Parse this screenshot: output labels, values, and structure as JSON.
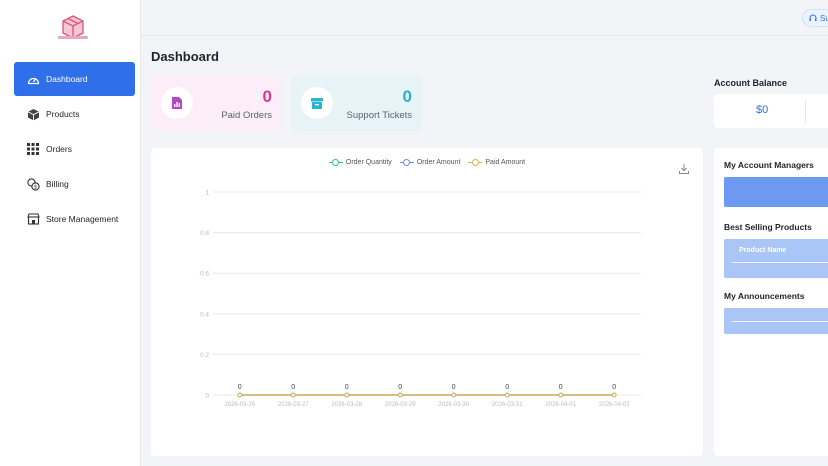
{
  "sidebar": {
    "items": [
      {
        "label": "Dashboard",
        "icon": "dashboard-gauge-icon",
        "active": true
      },
      {
        "label": "Products",
        "icon": "box-icon",
        "active": false
      },
      {
        "label": "Orders",
        "icon": "grid-icon",
        "active": false
      },
      {
        "label": "Billing",
        "icon": "coins-icon",
        "active": false
      },
      {
        "label": "Store Management",
        "icon": "store-icon",
        "active": false
      }
    ]
  },
  "topbar": {
    "support_label": "Su"
  },
  "page": {
    "title": "Dashboard"
  },
  "stats": [
    {
      "value": "0",
      "label": "Paid Orders",
      "icon": "chart-doc-icon",
      "bg": "#fbeef8",
      "color": "#d63a86",
      "icon_color": "#b245c8"
    },
    {
      "value": "0",
      "label": "Support Tickets",
      "icon": "archive-box-icon",
      "bg": "#e7f4f7",
      "color": "#27b3bd",
      "icon_color": "#2ab4cf"
    }
  ],
  "chart_data": {
    "type": "line",
    "legend": [
      "Order Quantity",
      "Order Amount",
      "Paid Amount"
    ],
    "series_colors": [
      "#3dbb8a",
      "#6a8fd8",
      "#e0b24a"
    ],
    "x": [
      "2026-03-26",
      "2026-03-27",
      "2026-03-28",
      "2026-03-29",
      "2026-03-30",
      "2026-03-31",
      "2026-04-01",
      "2026-04-02"
    ],
    "series": [
      {
        "name": "Order Quantity",
        "values": [
          0,
          0,
          0,
          0,
          0,
          0,
          0,
          0
        ]
      },
      {
        "name": "Order Amount",
        "values": [
          0,
          0,
          0,
          0,
          0,
          0,
          0,
          0
        ]
      },
      {
        "name": "Paid Amount",
        "values": [
          0,
          0,
          0,
          0,
          0,
          0,
          0,
          0
        ]
      }
    ],
    "data_labels": [
      "0",
      "0",
      "0",
      "0",
      "0",
      "0",
      "0",
      "0"
    ],
    "y_ticks": [
      "0",
      "0.2",
      "0.4",
      "0.6",
      "0.8",
      "1"
    ],
    "ylim": [
      0,
      1
    ],
    "grid": true
  },
  "account": {
    "title": "Account Balance",
    "balance": "$0"
  },
  "right_panel": {
    "managers_title": "My Account Managers",
    "best_selling_title": "Best Selling Products",
    "product_name_header": "Product Name",
    "announcements_title": "My Announcements"
  },
  "colors": {
    "accent": "#2f6fe9",
    "muted_bar": "#a9c6f7"
  }
}
